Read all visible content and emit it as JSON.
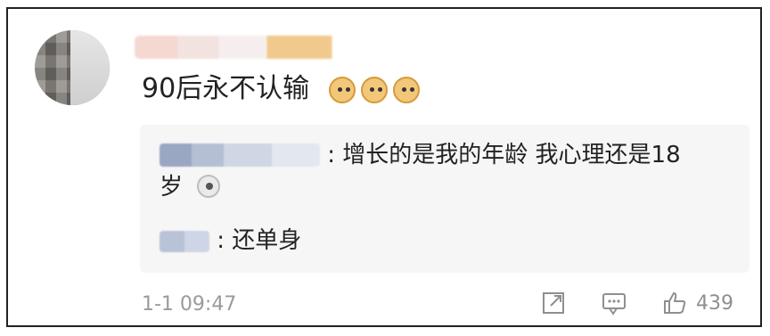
{
  "post": {
    "comment_text": "90后永不认输",
    "replies": [
      {
        "text_line1": "增长的是我的年龄 我心理还是18",
        "text_line2": "岁"
      },
      {
        "text": "还单身"
      }
    ],
    "timestamp": "1-1 09:47",
    "like_count": "439"
  },
  "icons": {
    "share": "share-icon",
    "comment": "comment-icon",
    "like": "thumbs-up-icon",
    "doge": "doge-emoji-icon",
    "dog": "dog-emoji-icon"
  }
}
